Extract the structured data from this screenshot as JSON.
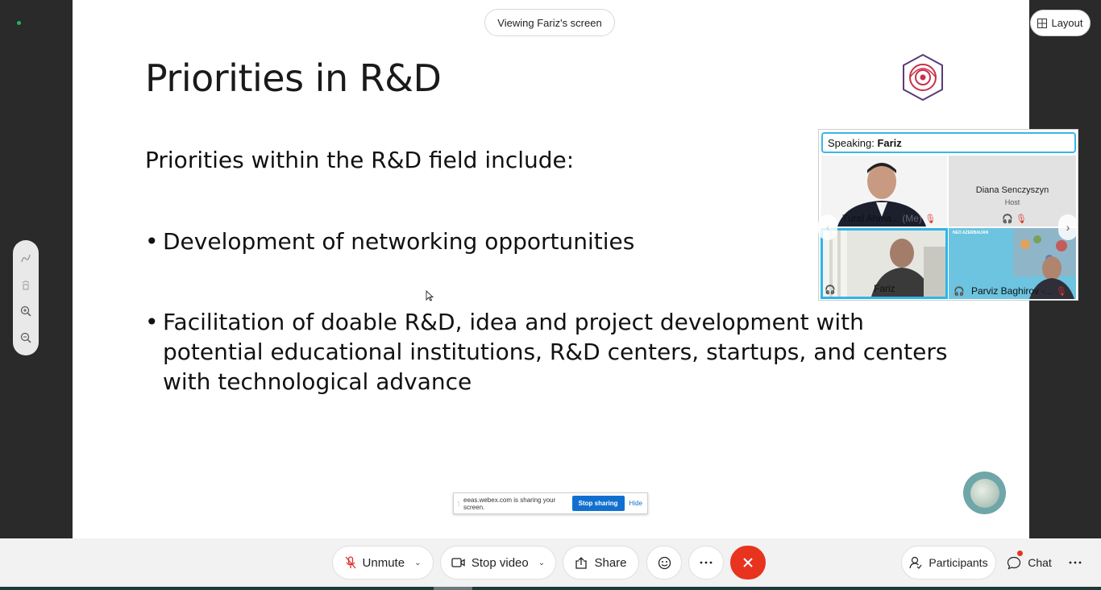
{
  "app": {
    "viewing_label": "Viewing Fariz's screen",
    "layout_label": "Layout"
  },
  "slide": {
    "title": "Priorities in R&D",
    "intro": "Priorities within the R&D field include:",
    "bullets": [
      "Development of networking opportunities",
      "Facilitation of doable R&D, idea and project development with potential educational institutions, R&D centers, startups, and centers with technological advance"
    ],
    "bullet_glyph": "•"
  },
  "sharing_bar": {
    "grip": "⁞",
    "message": "eeas.webex.com is sharing your screen.",
    "stop_label": "Stop sharing",
    "hide_label": "Hide"
  },
  "video_panel": {
    "speaking_prefix": "Speaking:",
    "speaking_name": "Fariz",
    "tiles": [
      {
        "name": "Tural Ahma...",
        "suffix": "(Me)"
      },
      {
        "name": "Diana Senczyszyn",
        "role": "Host"
      },
      {
        "name": "Fariz"
      },
      {
        "name": "Parviz Baghirov -..."
      }
    ],
    "parviz_banner": "NEO AZERBAIJAN"
  },
  "controls": {
    "unmute_label": "Unmute",
    "video_label": "Stop video",
    "share_label": "Share",
    "participants_label": "Participants",
    "chat_label": "Chat"
  },
  "colors": {
    "accent": "#2fb5e8",
    "leave": "#e8331f",
    "stop_sharing": "#1170cf"
  }
}
